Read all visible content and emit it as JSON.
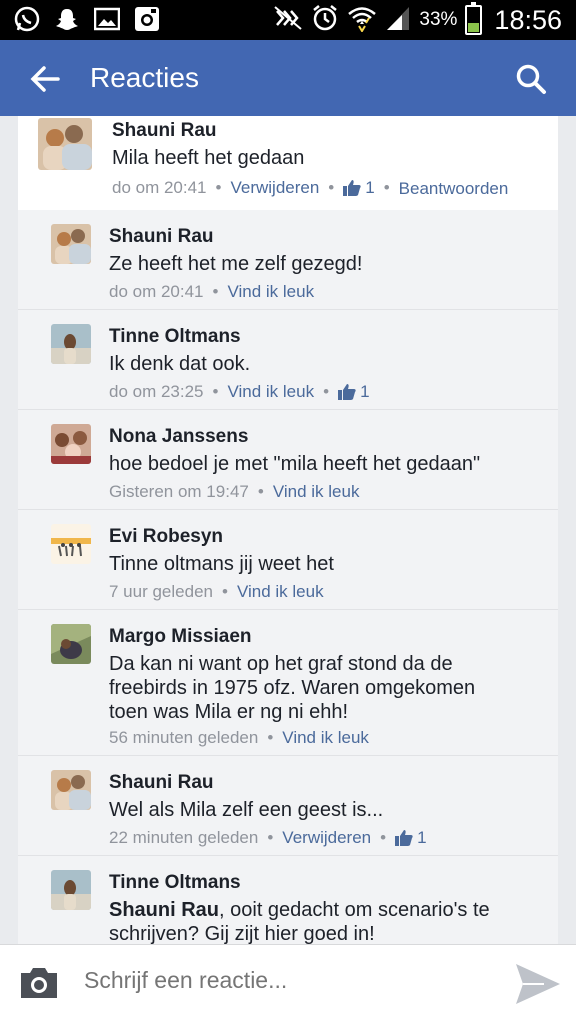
{
  "status_bar": {
    "left_icons": [
      "whatsapp-icon",
      "snapchat-icon",
      "gallery-icon",
      "instagram-icon"
    ],
    "right_icons": [
      "nfc-mute-icon",
      "alarm-icon",
      "wifi-icon",
      "signal-icon"
    ],
    "battery_percent": "33%",
    "battery_level": 0.33,
    "time": "18:56"
  },
  "app_bar": {
    "title": "Reacties",
    "color": "#4267b2"
  },
  "comments": [
    {
      "name": "Shauni Rau",
      "text": "Mila heeft het gedaan",
      "time": "do om 20:41",
      "action": "Verwijderen",
      "likes": "1",
      "reply": "Beantwoorden"
    },
    {
      "name": "Shauni Rau",
      "text": "Ze heeft het me zelf gezegd!",
      "time": "do om 20:41",
      "action": "Vind ik leuk"
    },
    {
      "name": "Tinne Oltmans",
      "text": "Ik denk dat ook.",
      "time": "do om 23:25",
      "action": "Vind ik leuk",
      "likes": "1"
    },
    {
      "name": "Nona Janssens",
      "text": "hoe bedoel je met \"mila heeft het gedaan\"",
      "time": "Gisteren om 19:47",
      "action": "Vind ik leuk"
    },
    {
      "name": "Evi Robesyn",
      "text": "Tinne oltmans jij weet het",
      "time": "7 uur geleden",
      "action": "Vind ik leuk"
    },
    {
      "name": "Margo Missiaen",
      "text": "Da kan ni want op het graf stond da de freebirds in 1975 ofz. Waren omgekomen toen was Mila er ng ni ehh!",
      "time": "56 minuten geleden",
      "action": "Vind ik leuk"
    },
    {
      "name": "Shauni Rau",
      "text": "Wel als Mila zelf een geest is...",
      "time": "22 minuten geleden",
      "action": "Verwijderen",
      "likes": "1"
    },
    {
      "name": "Tinne Oltmans",
      "mention": "Shauni Rau",
      "text": ", ooit gedacht om scenario's te schrijven? Gij zijt hier goed in!"
    }
  ],
  "input": {
    "placeholder": "Schrijf een reactie..."
  }
}
